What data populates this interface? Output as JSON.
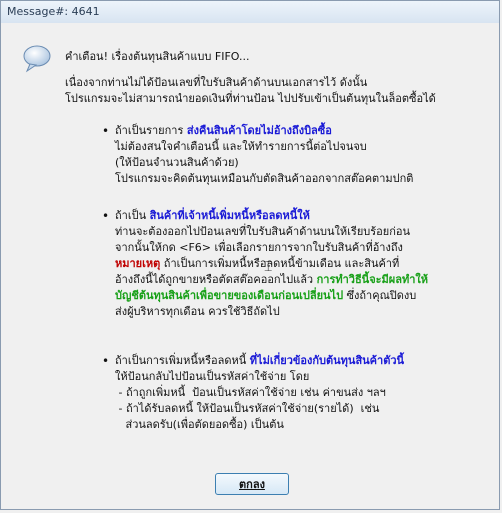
{
  "window": {
    "title": "Message#: 4641"
  },
  "message": {
    "heading": "คำเตือน!  เรื่องต้นทุนสินค้าแบบ FIFO...",
    "intro": [
      "เนื่องจากท่านไม่ได้ป้อนเลขที่ใบรับสินค้าด้านบนเอกสารไว้  ดังนั้น",
      "โปรแกรมจะไม่สามารถนำยอดเงินที่ท่านป้อน  ไปปรับเข้าเป็นต้นทุนในล็อตซื้อได้"
    ],
    "bullet1": {
      "prefix": "ถ้าเป็นรายการ ",
      "highlight": "ส่งคืนสินค้าโดยไม่อ้างถึงบิลซื้อ",
      "lines": [
        "ไม่ต้องสนใจคำเตือนนี้  และให้ทำรายการนี้ต่อไปจนจบ",
        "(ให้ป้อนจำนวนสินค้าด้วย)",
        "โปรแกรมจะคิดต้นทุนเหมือนกับตัดสินค้าออกจากสต๊อคตามปกติ"
      ]
    },
    "bullet2": {
      "prefix": "ถ้าเป็น ",
      "highlight": "สินค้าที่เจ้าหนี้เพิ่มหนี้หรือลดหนี้ให้",
      "line1": "ท่านจะต้องออกไปป้อนเลขที่ใบรับสินค้าด้านบนให้เรียบร้อยก่อน",
      "line2": "จากนั้นให้กด <F6> เพื่อเลือกรายการจากใบรับสินค้าที่อ้างถึง",
      "note_label": "หมายเหตุ",
      "line3_rest": " ถ้าเป็นการเพิ่มหนี้หรือลดหนี้ข้ามเดือน และสินค้าที่",
      "line4_start": "อ้างถึงนี้ได้ถูกขายหรือตัดสต๊อคออกไปแล้ว ",
      "line4_green": "การทำวิธีนี้จะมีผลทำให้",
      "line5_green": "บัญชีต้นทุนสินค้าเพื่อขายของเดือนก่อนเปลี่ยนไป",
      "line5_rest": " ซึ่งถ้าคุณปิดงบ",
      "line6": "ส่งผู้บริหารทุกเดือน ควรใช้วิธีถัดไป"
    },
    "bullet3": {
      "prefix": "ถ้าเป็นการเพิ่มหนี้หรือลดหนี้ ",
      "highlight": "ที่ไม่เกี่ยวข้องกับต้นทุนสินค้าตัวนี้",
      "lines": [
        "ให้ป้อนกลับไปป้อนเป็นรหัสค่าใช้จ่าย โดย",
        " - ถ้าถูกเพิ่มหนี้  ป้อนเป็นรหัสค่าใช้จ่าย เช่น ค่าขนส่ง ฯลฯ",
        " - ถ้าได้รับลดหนี้ ให้ป้อนเป็นรหัสค่าใช้จ่าย(รายได้)  เช่น",
        "   ส่วนลดรับ(เพื่อตัดยอดซื้อ) เป็นต้น"
      ]
    }
  },
  "buttons": {
    "ok": "ตกลง"
  }
}
